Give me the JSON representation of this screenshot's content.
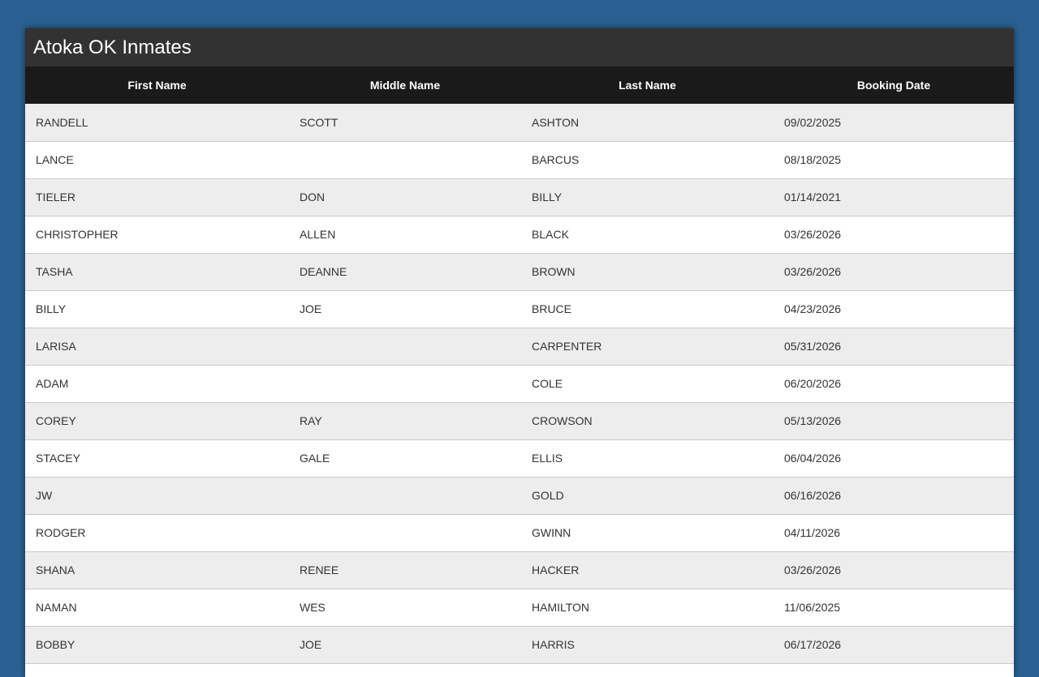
{
  "page": {
    "title": "Atoka OK Inmates"
  },
  "table": {
    "headers": {
      "first": "First Name",
      "middle": "Middle Name",
      "last": "Last Name",
      "booking": "Booking Date"
    },
    "rows": [
      {
        "first": "RANDELL",
        "middle": "SCOTT",
        "last": "ASHTON",
        "booking": "09/02/2025"
      },
      {
        "first": "LANCE",
        "middle": "",
        "last": "BARCUS",
        "booking": "08/18/2025"
      },
      {
        "first": "TIELER",
        "middle": "DON",
        "last": "BILLY",
        "booking": "01/14/2021"
      },
      {
        "first": "CHRISTOPHER",
        "middle": "ALLEN",
        "last": "BLACK",
        "booking": "03/26/2026"
      },
      {
        "first": "TASHA",
        "middle": "DEANNE",
        "last": "BROWN",
        "booking": "03/26/2026"
      },
      {
        "first": "BILLY",
        "middle": "JOE",
        "last": "BRUCE",
        "booking": "04/23/2026"
      },
      {
        "first": "LARISA",
        "middle": "",
        "last": "CARPENTER",
        "booking": "05/31/2026"
      },
      {
        "first": "ADAM",
        "middle": "",
        "last": "COLE",
        "booking": "06/20/2026"
      },
      {
        "first": "COREY",
        "middle": "RAY",
        "last": "CROWSON",
        "booking": "05/13/2026"
      },
      {
        "first": "STACEY",
        "middle": "GALE",
        "last": "ELLIS",
        "booking": "06/04/2026"
      },
      {
        "first": "JW",
        "middle": "",
        "last": "GOLD",
        "booking": "06/16/2026"
      },
      {
        "first": "RODGER",
        "middle": "",
        "last": "GWINN",
        "booking": "04/11/2026"
      },
      {
        "first": "SHANA",
        "middle": "RENEE",
        "last": "HACKER",
        "booking": "03/26/2026"
      },
      {
        "first": "NAMAN",
        "middle": "WES",
        "last": "HAMILTON",
        "booking": "11/06/2025"
      },
      {
        "first": "BOBBY",
        "middle": "JOE",
        "last": "HARRIS",
        "booking": "06/17/2026"
      }
    ]
  }
}
